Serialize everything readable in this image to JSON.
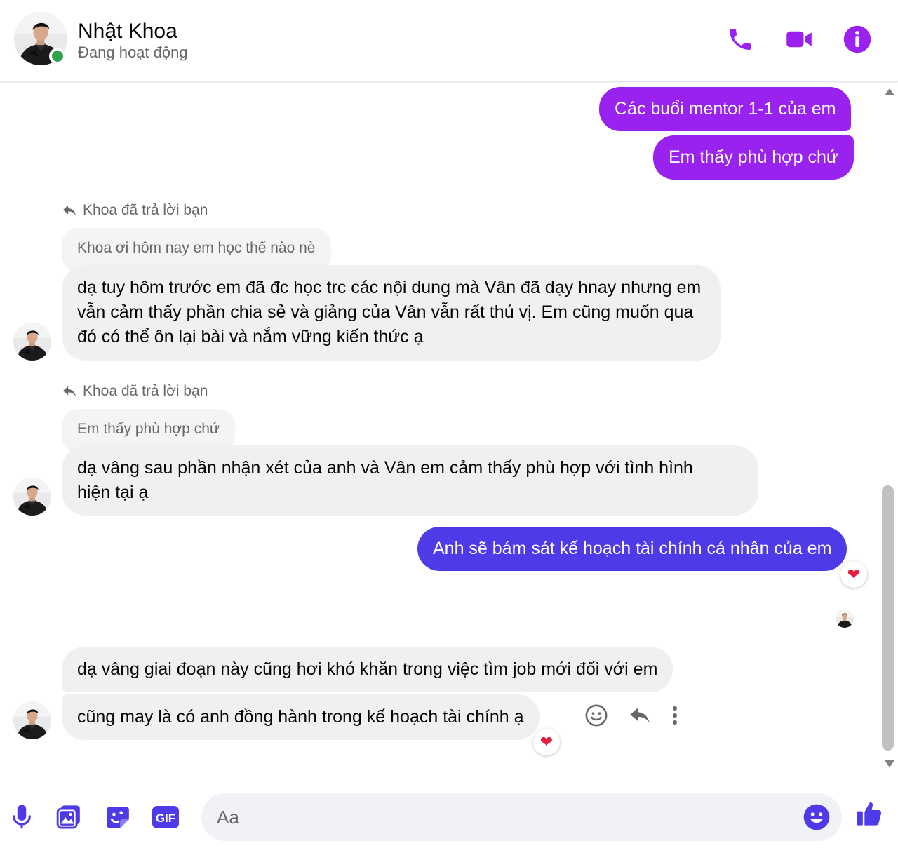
{
  "header": {
    "contact_name": "Nhật Khoa",
    "contact_status": "Đang hoạt động",
    "icons": [
      "phone-icon",
      "video-icon",
      "info-icon"
    ]
  },
  "theme": {
    "accent": "#9b21f0",
    "outgoing_purple": "#9a22ef",
    "outgoing_blue": "#4f3ae8",
    "online_green": "#31a24c",
    "reaction_red": "#e41e3f"
  },
  "messages": {
    "out_1": "Các buổi mentor 1-1 của em",
    "out_2": "Em thấy phù hợp chứ",
    "reply_note_1": "Khoa đã trả lời bạn",
    "quoted_1": "Khoa ơi hôm nay em học thế nào nè",
    "in_1_line1": "dạ tuy hôm trước em đã đc học trc các nội dung mà Vân đã dạy hnay nhưng em",
    "in_1_line2": "vẫn cảm thấy phần chia sẻ và giảng của Vân vẫn rất thú vị. Em cũng muốn qua",
    "in_1_line3": "đó có thể ôn lại bài và nắm vững kiến thức ạ",
    "reply_note_2": "Khoa đã trả lời bạn",
    "quoted_2": "Em thấy phù hợp chứ",
    "in_2_line1": "dạ vâng sau phần nhận xét của anh và Vân em cảm thấy phù hợp với tình hình",
    "in_2_line2": "hiện tại ạ",
    "out_3": "Anh sẽ bám sát kế hoạch tài chính cá nhân của em",
    "out_3_reaction": "❤",
    "in_3": "dạ vâng giai đoạn này cũng hơi khó khăn trong việc tìm job mới đối với em",
    "in_4": "cũng may là có anh đồng hành trong kế hoạch tài chính ạ",
    "in_4_reaction": "❤"
  },
  "composer": {
    "placeholder": "Aa",
    "icons": [
      "microphone-icon",
      "image-icon",
      "sticker-icon",
      "gif-icon",
      "emoji-icon",
      "like-icon"
    ],
    "gif_label": "GIF"
  }
}
